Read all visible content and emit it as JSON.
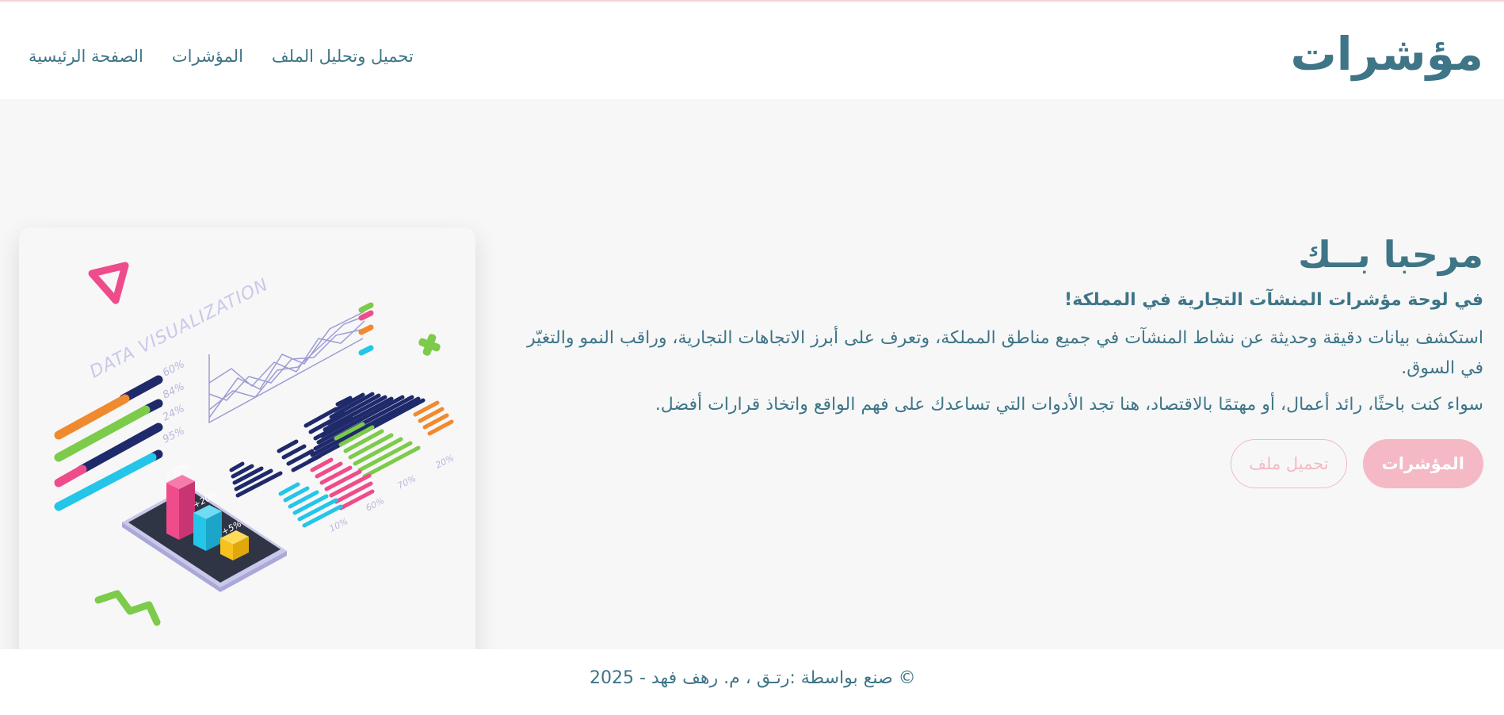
{
  "header": {
    "logo": "مؤشرات",
    "nav": [
      {
        "label": "الصفحة الرئيسية"
      },
      {
        "label": "المؤشرات"
      },
      {
        "label": "تحميل وتحليل الملف"
      }
    ]
  },
  "hero": {
    "title": "مرحبا بــك",
    "subtitle": "في لوحة مؤشرات المنشآت التجارية في المملكة!",
    "paragraph1": "استكشف بيانات دقيقة وحديثة عن نشاط المنشآت في جميع مناطق المملكة، وتعرف على أبرز الاتجاهات التجارية، وراقب النمو والتغيّر في السوق.",
    "paragraph2": "سواء كنت باحثًا، رائد أعمال، أو مهتمًا بالاقتصاد، هنا تجد الأدوات التي تساعدك على فهم الواقع واتخاذ قرارات أفضل.",
    "primary_button": "المؤشرات",
    "secondary_button": "تحميل ملف"
  },
  "illustration": {
    "caption": "DATA VISUALIZATION",
    "percent_labels": [
      "60%",
      "84%",
      "24%",
      "95%"
    ],
    "bar_labels": [
      "+30%",
      "+20%",
      "+5%"
    ],
    "stripe_labels": [
      "10%",
      "60%",
      "70%",
      "20%"
    ]
  },
  "footer": {
    "copyright": "© صنع بواسطة :رتـق ، م. رهف فهد - 2025"
  },
  "colors": {
    "primary": "#3e7587",
    "accent_pink": "#f4b9c5",
    "background": "#f7f7f7"
  }
}
